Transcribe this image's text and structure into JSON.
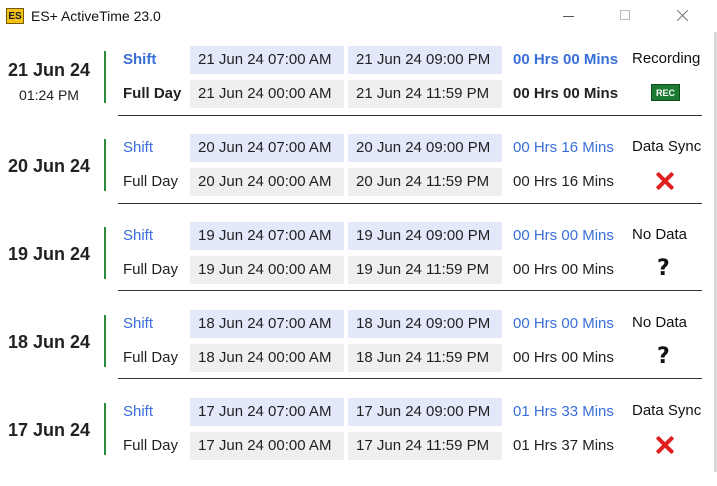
{
  "window": {
    "icon_text": "ES",
    "title": "ES+ ActiveTime 23.0"
  },
  "days": [
    {
      "date": "21 Jun 24",
      "time": "01:24 PM",
      "shift": {
        "label": "Shift",
        "start": "21 Jun 24 07:00 AM",
        "end": "21 Jun 24 09:00 PM",
        "duration": "00 Hrs  00 Mins",
        "status": "Recording"
      },
      "full": {
        "label": "Full Day",
        "start": "21 Jun 24 00:00 AM",
        "end": "21 Jun 24 11:59 PM",
        "duration": "00 Hrs  00 Mins",
        "badge": "REC",
        "icon": "rec-icon"
      }
    },
    {
      "date": "20 Jun 24",
      "shift": {
        "label": "Shift",
        "start": "20 Jun 24 07:00 AM",
        "end": "20 Jun 24 09:00 PM",
        "duration": "00 Hrs  16 Mins",
        "status": "Data Sync"
      },
      "full": {
        "label": "Full Day",
        "start": "20 Jun 24 00:00 AM",
        "end": "20 Jun 24 11:59 PM",
        "duration": "00 Hrs  16 Mins",
        "icon": "x-icon"
      }
    },
    {
      "date": "19 Jun 24",
      "shift": {
        "label": "Shift",
        "start": "19 Jun 24 07:00 AM",
        "end": "19 Jun 24 09:00 PM",
        "duration": "00 Hrs  00 Mins",
        "status": "No Data"
      },
      "full": {
        "label": "Full Day",
        "start": "19 Jun 24 00:00 AM",
        "end": "19 Jun 24 11:59 PM",
        "duration": "00 Hrs  00 Mins",
        "icon": "question-icon",
        "glyph": "?"
      }
    },
    {
      "date": "18 Jun 24",
      "shift": {
        "label": "Shift",
        "start": "18 Jun 24 07:00 AM",
        "end": "18 Jun 24 09:00 PM",
        "duration": "00 Hrs  00 Mins",
        "status": "No Data"
      },
      "full": {
        "label": "Full Day",
        "start": "18 Jun 24 00:00 AM",
        "end": "18 Jun 24 11:59 PM",
        "duration": "00 Hrs  00 Mins",
        "icon": "question-icon",
        "glyph": "?"
      }
    },
    {
      "date": "17 Jun 24",
      "shift": {
        "label": "Shift",
        "start": "17 Jun 24 07:00 AM",
        "end": "17 Jun 24 09:00 PM",
        "duration": "01 Hrs  33 Mins",
        "status": "Data Sync"
      },
      "full": {
        "label": "Full Day",
        "start": "17 Jun 24 00:00 AM",
        "end": "17 Jun 24 11:59 PM",
        "duration": "01 Hrs  37 Mins",
        "icon": "x-icon"
      }
    }
  ],
  "colors": {
    "shift_text": "#3a6fd8",
    "shift_cell_bg": "#e3e8fb",
    "full_cell_bg": "#efefef",
    "day_bar": "#2e8b3e",
    "rec_badge": "#1d7a32",
    "error_x": "#e02020"
  }
}
